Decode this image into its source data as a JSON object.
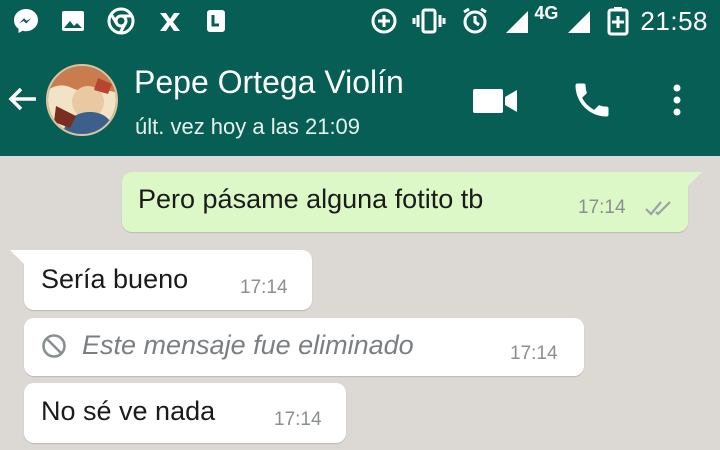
{
  "status_bar": {
    "time": "21:58",
    "network": "4G",
    "icons": [
      "messenger-icon",
      "gallery-icon",
      "chrome-icon",
      "app-icon",
      "app-icon-2",
      "data-saver-icon",
      "vibrate-icon",
      "alarm-icon",
      "signal-icon",
      "signal-icon-2",
      "battery-charging-icon"
    ]
  },
  "header": {
    "contact_name": "Pepe Ortega Violín",
    "last_seen": "últ. vez hoy a las 21:09",
    "icons": [
      "back-arrow-icon",
      "video-call-icon",
      "phone-call-icon",
      "more-options-icon"
    ],
    "color": "#075e54"
  },
  "messages": [
    {
      "direction": "outgoing",
      "text": "Pero pásame alguna fotito tb",
      "time": "17:14",
      "status": "read-double-check"
    },
    {
      "direction": "incoming",
      "text": "Sería bueno",
      "time": "17:14"
    },
    {
      "direction": "incoming",
      "text": "Este mensaje fue eliminado",
      "time": "17:14",
      "deleted": true
    },
    {
      "direction": "incoming",
      "text": "No sé ve nada",
      "time": "17:14"
    }
  ],
  "colors": {
    "outgoing_bubble": "#dcf8c6",
    "incoming_bubble": "#ffffff",
    "chat_background": "#dcd9d4"
  }
}
